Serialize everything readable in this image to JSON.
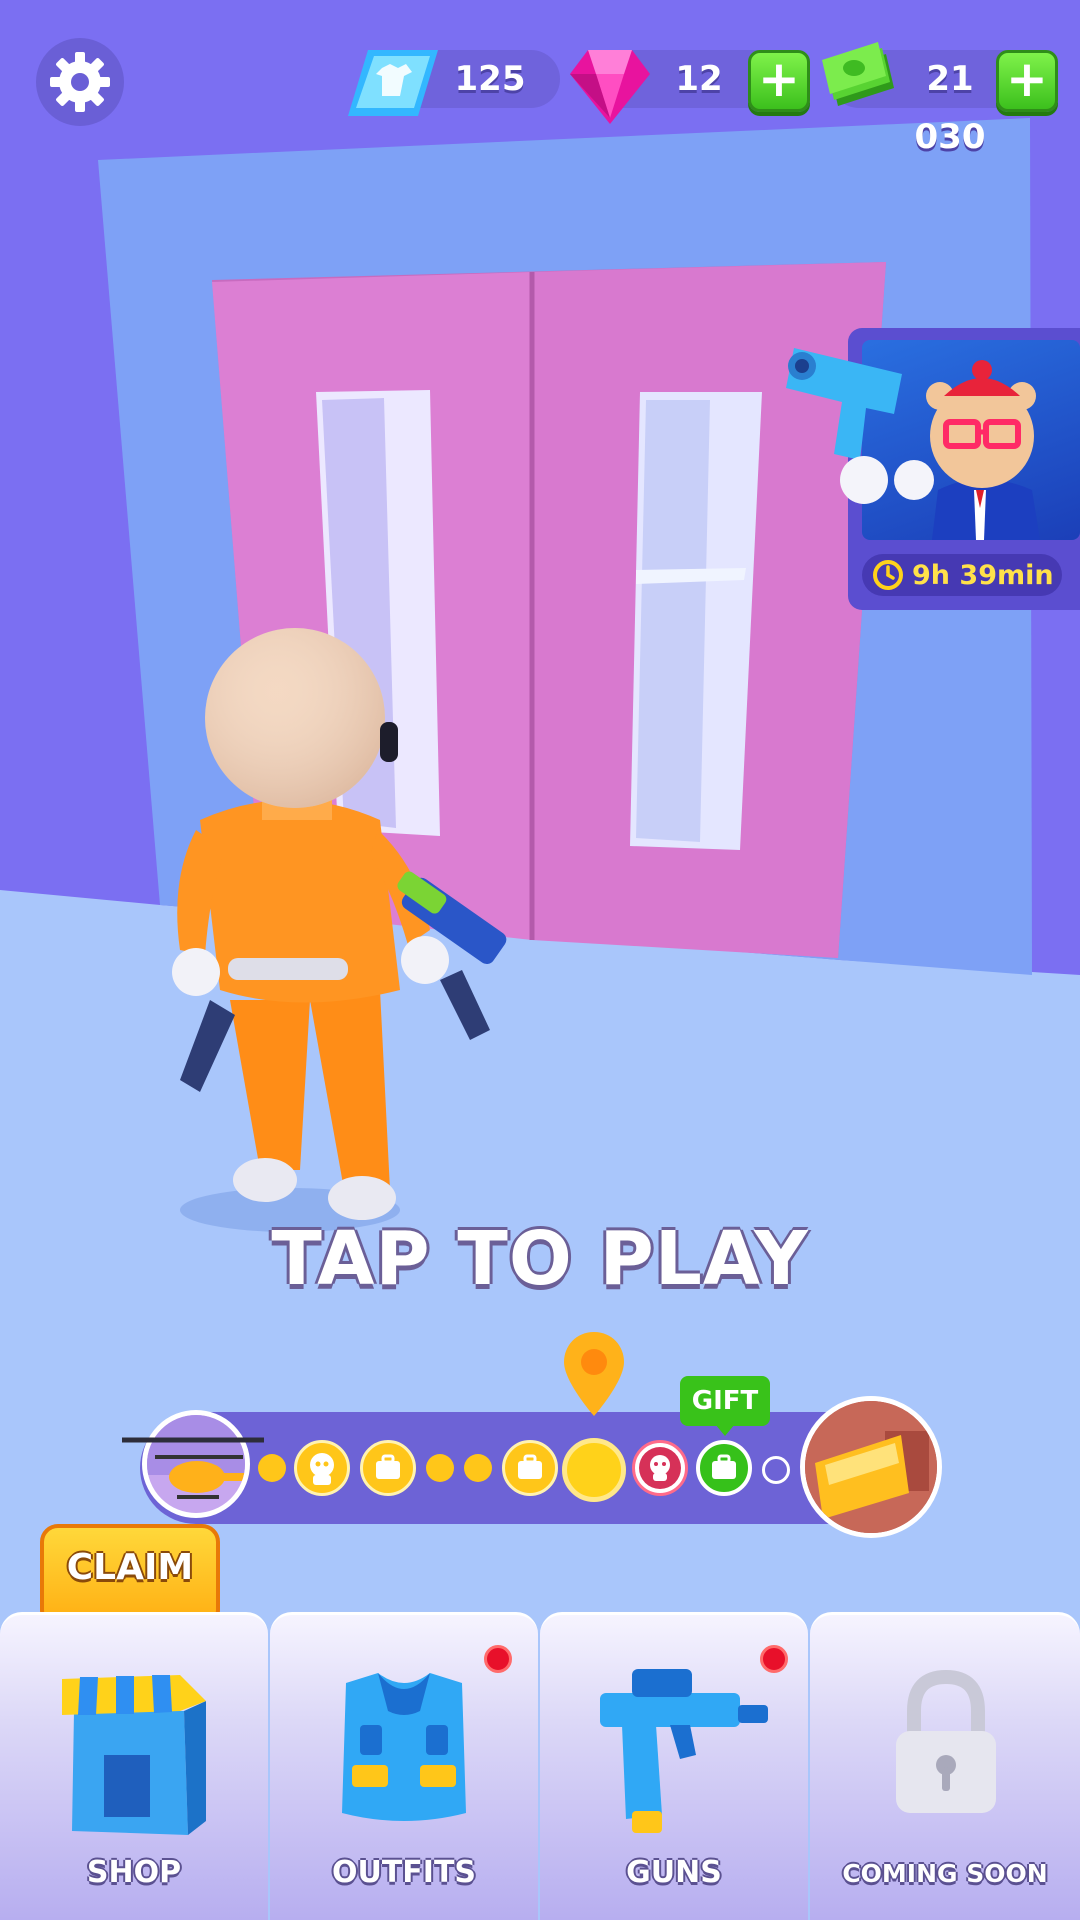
{
  "currencies": {
    "outfits_tokens": "125",
    "gems": "12",
    "cash": "21 030"
  },
  "offer": {
    "timer": "9h 39min"
  },
  "tap_to_play": "TAP TO PLAY",
  "level_progress": {
    "gift_label": "GIFT",
    "nodes": [
      "dot",
      "zombie",
      "briefcase",
      "dot",
      "dot",
      "briefcase",
      "current",
      "zombie-boss",
      "gift-briefcase",
      "dot-empty"
    ]
  },
  "claim_label": "CLAIM",
  "nav": {
    "shop": "SHOP",
    "outfits": "OUTFITS",
    "guns": "GUNS",
    "coming_soon": "COMING SOON"
  },
  "colors": {
    "wall": "#7b6ff2",
    "floor": "#a9c6fb",
    "door": "#d97ad2",
    "accent_green": "#3cc01d",
    "accent_yellow": "#ffc619"
  }
}
